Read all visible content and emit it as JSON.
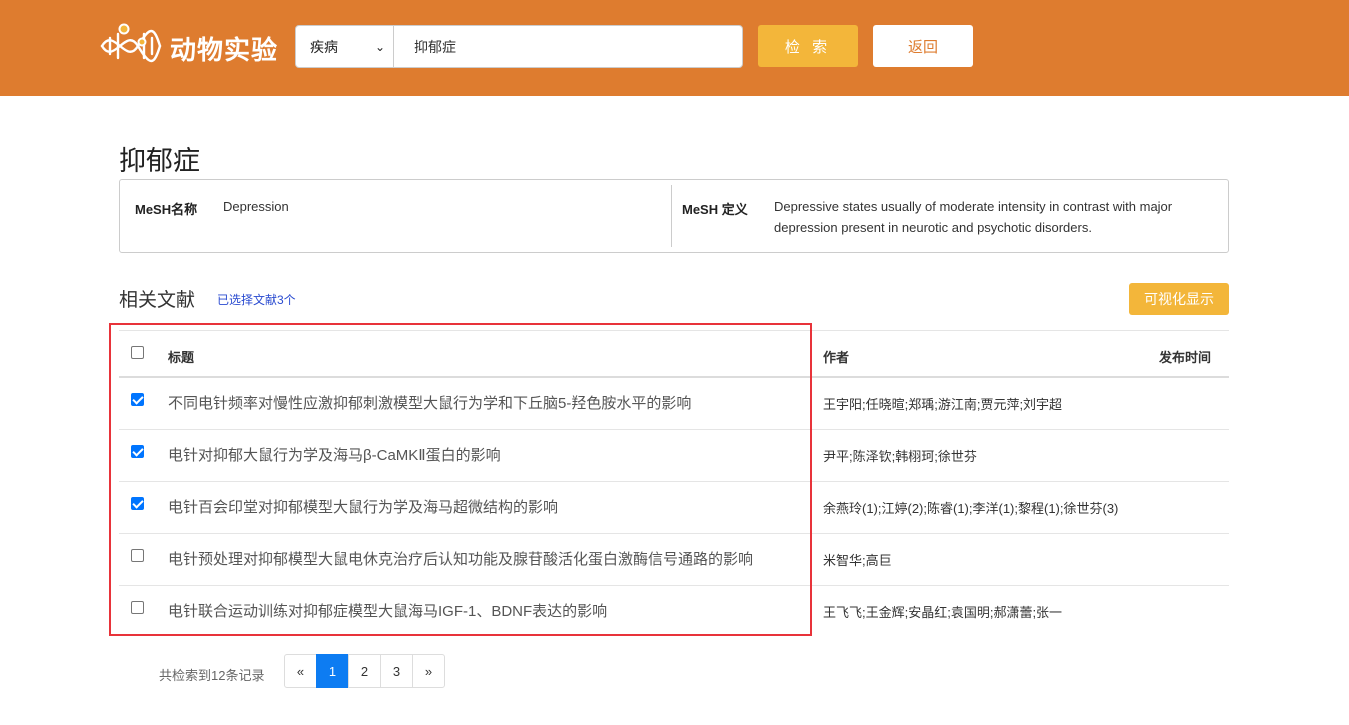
{
  "header": {
    "app_title": "动物实验",
    "search": {
      "category": "疾病",
      "query": "抑郁症"
    },
    "search_button": "检 索",
    "back_button": "返回"
  },
  "page_title": "抑郁症",
  "mesh": {
    "name_label": "MeSH名称",
    "name_value": "Depression",
    "definition_label": "MeSH 定义",
    "definition_value": "Depressive states usually of moderate intensity in contrast with major depression present in neurotic and psychotic disorders."
  },
  "literature": {
    "title": "相关文献",
    "selected_text": "已选择文献3个",
    "visualize_button": "可视化显示",
    "columns": {
      "title": "标题",
      "author": "作者",
      "date": "发布时间"
    },
    "rows": [
      {
        "checked": true,
        "title": "不同电针频率对慢性应激抑郁刺激模型大鼠行为学和下丘脑5-羟色胺水平的影响",
        "author": "王宇阳;任晓暄;郑瑀;游江南;贾元萍;刘宇超"
      },
      {
        "checked": true,
        "title": "电针对抑郁大鼠行为学及海马β-CaMKⅡ蛋白的影响",
        "author": "尹平;陈泽钦;韩栩珂;徐世芬"
      },
      {
        "checked": true,
        "title": "电针百会印堂对抑郁模型大鼠行为学及海马超微结构的影响",
        "author": "余燕玲(1);江婷(2);陈睿(1);李洋(1);黎程(1);徐世芬(3)"
      },
      {
        "checked": false,
        "title": "电针预处理对抑郁模型大鼠电休克治疗后认知功能及腺苷酸活化蛋白激酶信号通路的影响",
        "author": "米智华;高巨"
      },
      {
        "checked": false,
        "title": "电针联合运动训练对抑郁症模型大鼠海马IGF-1、BDNF表达的影响",
        "author": "王飞飞;王金辉;安晶红;袁国明;郝潇蕾;张一"
      }
    ]
  },
  "pagination": {
    "total_text": "共检索到12条记录",
    "prev": "«",
    "pages": [
      "1",
      "2",
      "3"
    ],
    "active_page": "1",
    "next": "»"
  },
  "colors": {
    "header_bg": "#de7c2f",
    "accent_button": "#f3b63a",
    "highlight_border": "#e8333a",
    "active_page": "#0d7cf2"
  }
}
